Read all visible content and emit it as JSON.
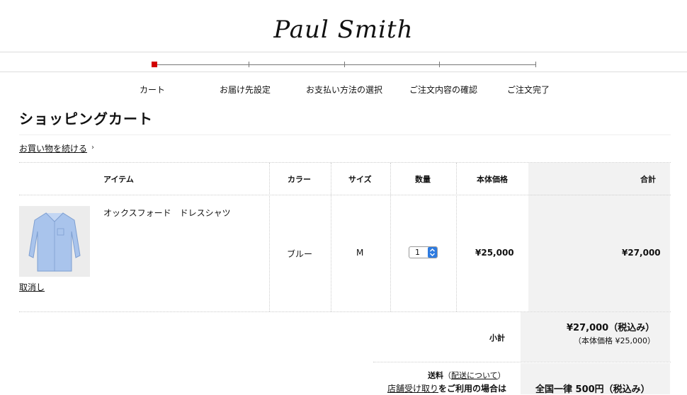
{
  "brand": {
    "logo_text": "Paul Smith"
  },
  "steps": [
    {
      "label": "カート",
      "active": true
    },
    {
      "label": "お届け先設定",
      "active": false
    },
    {
      "label": "お支払い方法の選択",
      "active": false
    },
    {
      "label": "ご注文内容の確認",
      "active": false
    },
    {
      "label": "ご注文完了",
      "active": false
    }
  ],
  "page": {
    "title": "ショッピングカート",
    "continue_label": "お買い物を続ける"
  },
  "table": {
    "headers": {
      "item": "アイテム",
      "color": "カラー",
      "size": "サイズ",
      "qty": "数量",
      "price": "本体価格",
      "total": "合計"
    },
    "row": {
      "name": "オックスフォード　ドレスシャツ",
      "remove_label": "取消し",
      "color": "ブルー",
      "size": "M",
      "qty": "1",
      "price": "¥25,000",
      "total": "¥27,000"
    }
  },
  "summary": {
    "subtotal_label": "小計",
    "subtotal_value": "¥27,000（税込み）",
    "subtotal_note": "（本体価格 ¥25,000）",
    "shipping_label": "送料",
    "shipping_paren_open": "（",
    "shipping_link": "配送について",
    "shipping_paren_close": "）",
    "store_pickup_link": "店舗受け取り",
    "store_pickup_rest": "をご利用の場合は",
    "shipping_value": "全国一律 500円（税込み）"
  },
  "colors": {
    "accent": "#d20000",
    "qty_button": "#2e7be0",
    "total_bg": "#f2f2f2"
  }
}
